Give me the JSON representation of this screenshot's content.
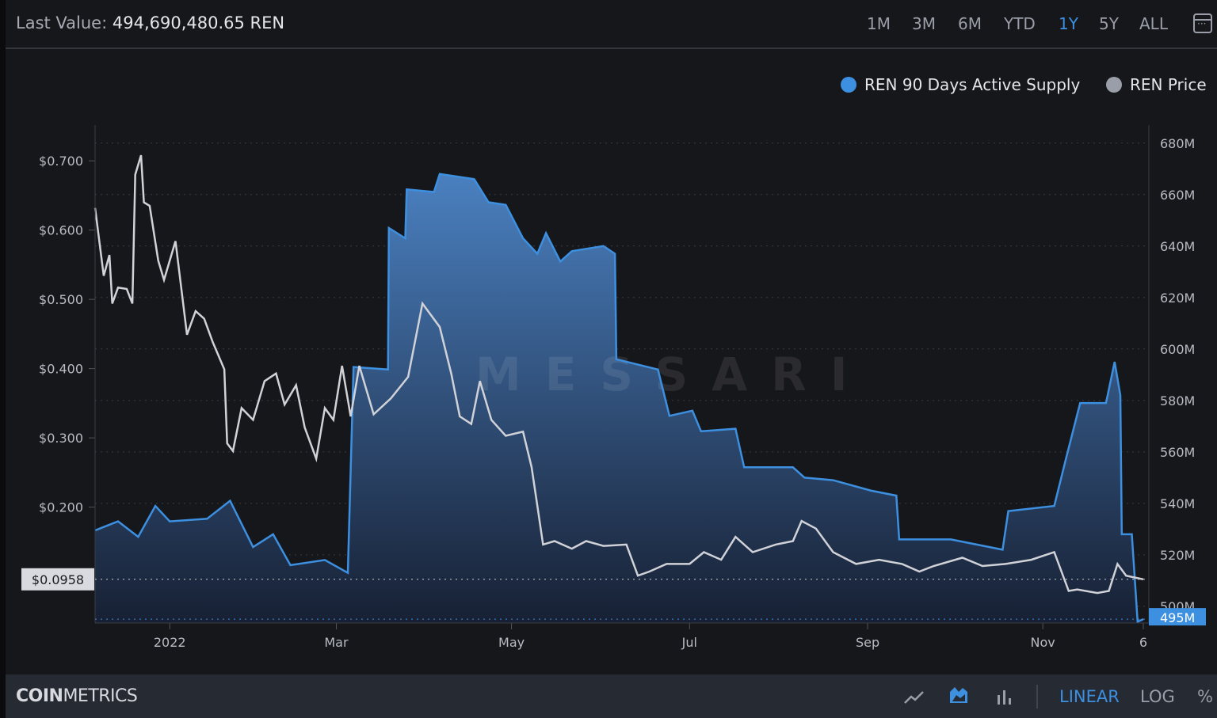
{
  "header": {
    "last_value_label": "Last Value:",
    "last_value": "494,690,480.65 REN",
    "ranges": [
      "1M",
      "3M",
      "6M",
      "YTD",
      "1Y",
      "5Y",
      "ALL"
    ],
    "active_range": "1Y"
  },
  "legend": [
    {
      "label": "REN 90 Days Active Supply",
      "color": "#3d8fe0"
    },
    {
      "label": "REN Price",
      "color": "#9a9ea8"
    }
  ],
  "watermark": "MESSARI",
  "footer": {
    "logo_bold": "COIN",
    "logo_rest": "METRICS",
    "scale_linear": "LINEAR",
    "scale_log": "LOG",
    "scale_pct": "%"
  },
  "chart_data": {
    "type": "area",
    "x_unit": "days since 2021-12-06",
    "x_ticks": [
      {
        "label": "2022",
        "x": 26
      },
      {
        "label": "Mar",
        "x": 84
      },
      {
        "label": "May",
        "x": 145
      },
      {
        "label": "Jul",
        "x": 207
      },
      {
        "label": "Sep",
        "x": 269
      },
      {
        "label": "Nov",
        "x": 330
      },
      {
        "label": "6",
        "x": 365
      }
    ],
    "xlim": [
      0,
      365
    ],
    "left_axis": {
      "label": "REN Price",
      "ylim": [
        0.0327,
        0.7516
      ],
      "ticks": [
        "$0.200",
        "$0.300",
        "$0.400",
        "$0.500",
        "$0.600",
        "$0.700"
      ],
      "tick_values": [
        0.2,
        0.3,
        0.4,
        0.5,
        0.6,
        0.7
      ],
      "current": "$0.0958"
    },
    "right_axis": {
      "label": "REN 90 Days Active Supply",
      "ylim": [
        493.5,
        687
      ],
      "ticks": [
        "500M",
        "520M",
        "540M",
        "560M",
        "580M",
        "600M",
        "620M",
        "640M",
        "660M",
        "680M"
      ],
      "tick_values": [
        500,
        520,
        540,
        560,
        580,
        600,
        620,
        640,
        660,
        680
      ],
      "current": "495M"
    },
    "series": [
      {
        "name": "REN 90 Days Active Supply",
        "unit": "M REN",
        "axis": "right",
        "color": "#3d8fe0",
        "points": [
          [
            0,
            529.5
          ],
          [
            8,
            533
          ],
          [
            15,
            527
          ],
          [
            21,
            539
          ],
          [
            26,
            533
          ],
          [
            39,
            534
          ],
          [
            47,
            541
          ],
          [
            55,
            523
          ],
          [
            62,
            528
          ],
          [
            68,
            516
          ],
          [
            80,
            518
          ],
          [
            88,
            513
          ],
          [
            90,
            593
          ],
          [
            102,
            592
          ],
          [
            102.3,
            647
          ],
          [
            108,
            643
          ],
          [
            108.5,
            662
          ],
          [
            118,
            661
          ],
          [
            120,
            668
          ],
          [
            132,
            666
          ],
          [
            137,
            657
          ],
          [
            143,
            656
          ],
          [
            149,
            643
          ],
          [
            154,
            637
          ],
          [
            157,
            645
          ],
          [
            162,
            634
          ],
          [
            166,
            638
          ],
          [
            177,
            640
          ],
          [
            181,
            637
          ],
          [
            181.5,
            596
          ],
          [
            196,
            592
          ],
          [
            200,
            574
          ],
          [
            208,
            576
          ],
          [
            211,
            568
          ],
          [
            223,
            569
          ],
          [
            226,
            554
          ],
          [
            243,
            554
          ],
          [
            247,
            550
          ],
          [
            257,
            549
          ],
          [
            270,
            545
          ],
          [
            279,
            543
          ],
          [
            280,
            526
          ],
          [
            298,
            526
          ],
          [
            316,
            522
          ],
          [
            318,
            537
          ],
          [
            334,
            539
          ],
          [
            338,
            557
          ],
          [
            343,
            579
          ],
          [
            352,
            579
          ],
          [
            355,
            595
          ],
          [
            357,
            582
          ],
          [
            357.5,
            528
          ],
          [
            361,
            528
          ],
          [
            363,
            494
          ],
          [
            365,
            495
          ]
        ]
      },
      {
        "name": "REN Price",
        "unit": "USD",
        "axis": "left",
        "color": "#d0d2d8",
        "points": [
          [
            0,
            0.632
          ],
          [
            3,
            0.534
          ],
          [
            5,
            0.564
          ],
          [
            6,
            0.494
          ],
          [
            8,
            0.517
          ],
          [
            11,
            0.515
          ],
          [
            13,
            0.494
          ],
          [
            14,
            0.68
          ],
          [
            16,
            0.708
          ],
          [
            17,
            0.64
          ],
          [
            19,
            0.635
          ],
          [
            22,
            0.556
          ],
          [
            24,
            0.528
          ],
          [
            28,
            0.584
          ],
          [
            32,
            0.449
          ],
          [
            35,
            0.483
          ],
          [
            38,
            0.472
          ],
          [
            41,
            0.438
          ],
          [
            45,
            0.399
          ],
          [
            46,
            0.292
          ],
          [
            48,
            0.281
          ],
          [
            51,
            0.343
          ],
          [
            55,
            0.326
          ],
          [
            59,
            0.382
          ],
          [
            63,
            0.393
          ],
          [
            66,
            0.348
          ],
          [
            70,
            0.376
          ],
          [
            73,
            0.315
          ],
          [
            77,
            0.27
          ],
          [
            80,
            0.343
          ],
          [
            83,
            0.326
          ],
          [
            86,
            0.404
          ],
          [
            89,
            0.331
          ],
          [
            92,
            0.404
          ],
          [
            97,
            0.334
          ],
          [
            103,
            0.357
          ],
          [
            109,
            0.388
          ],
          [
            114,
            0.494
          ],
          [
            120,
            0.46
          ],
          [
            124,
            0.393
          ],
          [
            127,
            0.331
          ],
          [
            131,
            0.32
          ],
          [
            134,
            0.382
          ],
          [
            138,
            0.326
          ],
          [
            143,
            0.303
          ],
          [
            149,
            0.309
          ],
          [
            152,
            0.258
          ],
          [
            154,
            0.202
          ],
          [
            156,
            0.146
          ],
          [
            160,
            0.151
          ],
          [
            166,
            0.14
          ],
          [
            171,
            0.151
          ],
          [
            177,
            0.144
          ],
          [
            185,
            0.146
          ],
          [
            189,
            0.101
          ],
          [
            193,
            0.107
          ],
          [
            199,
            0.118
          ],
          [
            207,
            0.118
          ],
          [
            212,
            0.135
          ],
          [
            218,
            0.124
          ],
          [
            223,
            0.157
          ],
          [
            229,
            0.135
          ],
          [
            237,
            0.146
          ],
          [
            243,
            0.151
          ],
          [
            246,
            0.18
          ],
          [
            251,
            0.169
          ],
          [
            257,
            0.135
          ],
          [
            265,
            0.118
          ],
          [
            273,
            0.124
          ],
          [
            281,
            0.118
          ],
          [
            287,
            0.107
          ],
          [
            292,
            0.115
          ],
          [
            302,
            0.127
          ],
          [
            309,
            0.115
          ],
          [
            317,
            0.118
          ],
          [
            326,
            0.124
          ],
          [
            334,
            0.135
          ],
          [
            339,
            0.079
          ],
          [
            342,
            0.081
          ],
          [
            349,
            0.076
          ],
          [
            353,
            0.079
          ],
          [
            356,
            0.118
          ],
          [
            359,
            0.101
          ],
          [
            365,
            0.0958
          ]
        ]
      }
    ]
  }
}
